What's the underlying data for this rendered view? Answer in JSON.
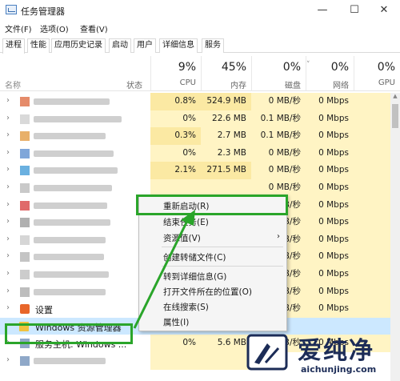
{
  "window": {
    "title": "任务管理器",
    "min_glyph": "—",
    "max_glyph": "☐",
    "close_glyph": "✕"
  },
  "menu": {
    "file": "文件(F)",
    "options": "选项(O)",
    "view": "查看(V)"
  },
  "tabs": [
    "进程",
    "性能",
    "应用历史记录",
    "启动",
    "用户",
    "详细信息",
    "服务"
  ],
  "header": {
    "name": "名称",
    "status": "状态",
    "cpu_pct": "9%",
    "cpu": "CPU",
    "mem_pct": "45%",
    "mem": "内存",
    "disk_pct": "0%",
    "disk": "磁盘",
    "net_pct": "0%",
    "net": "网络",
    "gpu_pct": "0%",
    "gpu": "GPU"
  },
  "rows": [
    {
      "name": "",
      "cpu": "0.8%",
      "mem": "524.9 MB",
      "disk": "0 MB/秒",
      "net": "0 Mbps"
    },
    {
      "name": "",
      "cpu": "0%",
      "mem": "22.6 MB",
      "disk": "0.1 MB/秒",
      "net": "0 Mbps"
    },
    {
      "name": "",
      "cpu": "0.3%",
      "mem": "2.7 MB",
      "disk": "0.1 MB/秒",
      "net": "0 Mbps"
    },
    {
      "name": "",
      "cpu": "0%",
      "mem": "2.3 MB",
      "disk": "0 MB/秒",
      "net": "0 Mbps"
    },
    {
      "name": "",
      "cpu": "2.1%",
      "mem": "271.5 MB",
      "disk": "0 MB/秒",
      "net": "0 Mbps"
    },
    {
      "name": "",
      "cpu": "",
      "mem": "",
      "disk": "0 MB/秒",
      "net": "0 Mbps"
    },
    {
      "name": "",
      "cpu": "",
      "mem": "",
      "disk": "0 MB/秒",
      "net": "0 Mbps"
    },
    {
      "name": "",
      "cpu": "",
      "mem": "",
      "disk": "0 MB/秒",
      "net": "0 Mbps"
    },
    {
      "name": "",
      "cpu": "",
      "mem": "",
      "disk": "0 MB/秒",
      "net": "0 Mbps"
    },
    {
      "name": "",
      "cpu": "",
      "mem": "",
      "disk": "0 MB/秒",
      "net": "0 Mbps"
    },
    {
      "name": "",
      "cpu": "",
      "mem": "",
      "disk": "0 MB/秒",
      "net": "0 Mbps"
    },
    {
      "name": "",
      "cpu": "",
      "mem": "",
      "disk": "0 MB/秒",
      "net": "0 Mbps"
    },
    {
      "name": "设置",
      "cpu": "",
      "mem": "",
      "disk": "0 MB/秒",
      "net": "0 Mbps"
    },
    {
      "name": "Windows 资源管理器",
      "cpu": "0%",
      "mem": "6.8 MB",
      "disk": "",
      "net": ""
    },
    {
      "name": "服务主机: Windows ...",
      "cpu": "0%",
      "mem": "5.6 MB",
      "disk": "0 MB/秒",
      "net": "0 Mbps"
    },
    {
      "name": "",
      "cpu": "",
      "mem": "",
      "disk": "",
      "net": ""
    }
  ],
  "context_menu": {
    "restart": "重新启动(R)",
    "end_task": "结束任务(E)",
    "resource_values": "资源值(V)",
    "dump_file": "创建转储文件(C)",
    "go_to_details": "转到详细信息(G)",
    "open_location": "打开文件所在的位置(O)",
    "search_online": "在线搜索(S)",
    "properties": "属性(I)"
  },
  "watermark": {
    "text": "爱纯净",
    "url": "aichunjing.com"
  },
  "colors": {
    "highlight_green": "#2aa52a",
    "heat_light": "#fff4c4",
    "heat": "#fbe9a3"
  }
}
